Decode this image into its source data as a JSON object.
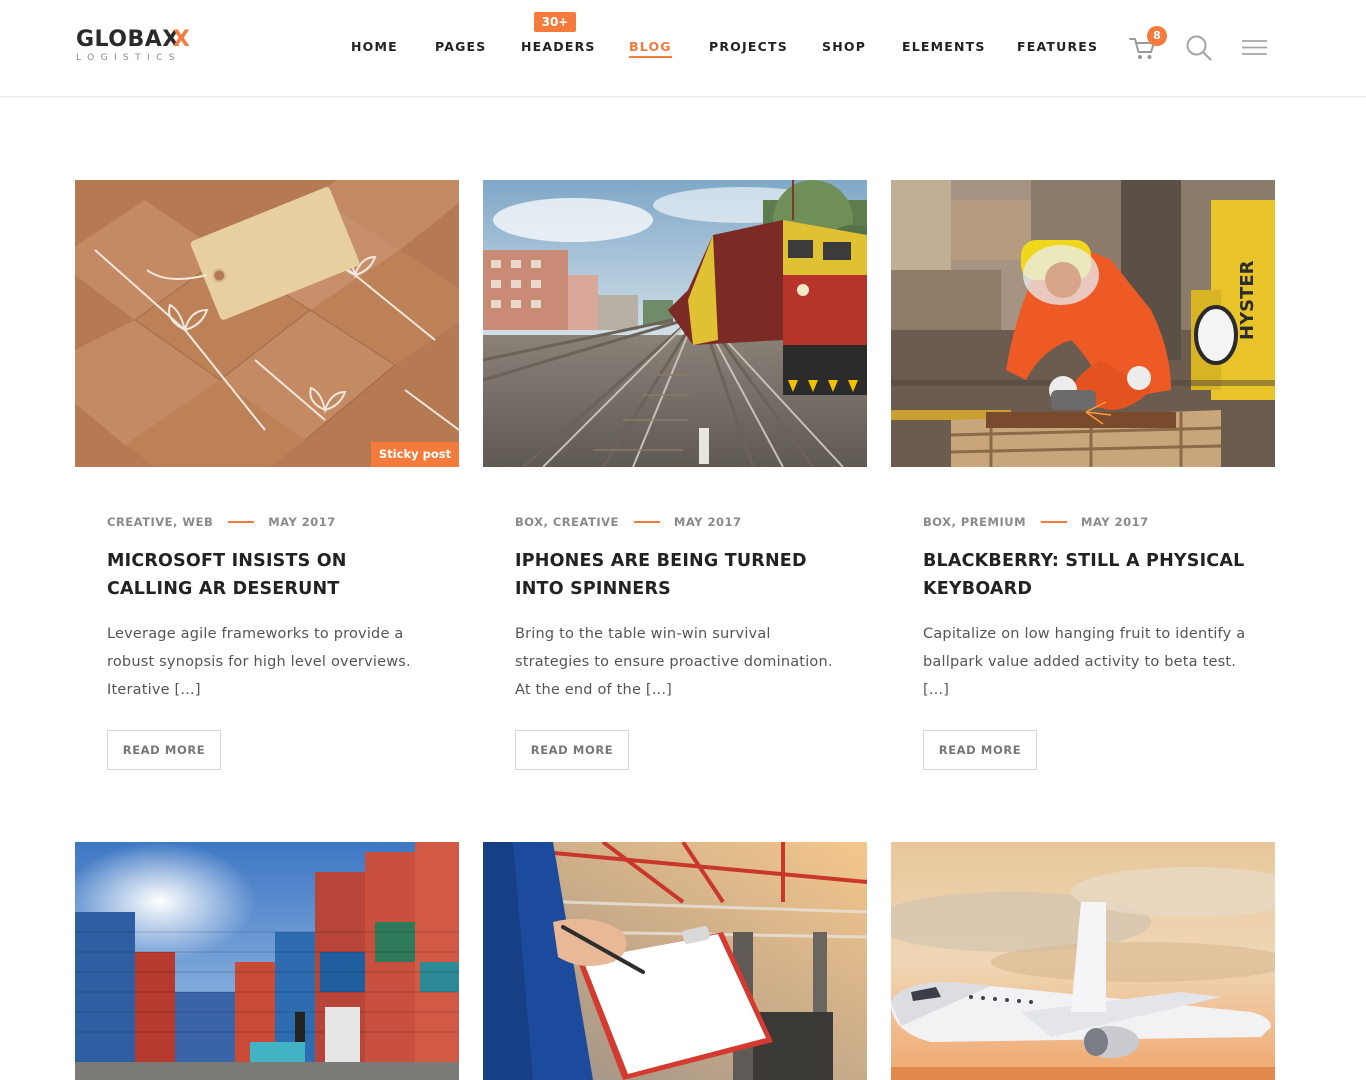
{
  "brand": {
    "name_main": "GLOBA",
    "name_x1": "X",
    "name_x2": "X",
    "tagline": "LOGISTICS",
    "accent_color": "#f47b3c"
  },
  "nav": {
    "items": [
      {
        "label": "HOME",
        "active": false
      },
      {
        "label": "PAGES",
        "active": false
      },
      {
        "label": "HEADERS",
        "active": false
      },
      {
        "label": "BLOG",
        "active": true
      },
      {
        "label": "PROJECTS",
        "active": false
      },
      {
        "label": "SHOP",
        "active": false
      },
      {
        "label": "ELEMENTS",
        "active": false
      },
      {
        "label": "FEATURES",
        "active": false
      }
    ],
    "headers_badge": "30+",
    "cart_count": "8",
    "icons": [
      "cart-icon",
      "search-icon",
      "hamburger-menu-icon"
    ]
  },
  "posts": [
    {
      "image": "brown-parcels-with-tag",
      "sticky_label": "Sticky post",
      "categories": "CREATIVE, WEB",
      "date": "MAY 2017",
      "title": "MICROSOFT INSISTS ON CALLING AR DESERUNT",
      "excerpt": "Leverage agile frameworks to provide a robust synopsis for high level overviews. Iterative [...]",
      "read_more": "READ MORE"
    },
    {
      "image": "locomotive-on-railway",
      "categories": "BOX, CREATIVE",
      "date": "MAY 2017",
      "title": "IPHONES ARE BEING TURNED INTO SPINNERS",
      "excerpt": "Bring to the table win-win survival strategies to ensure proactive domination. At the end of the [...]",
      "read_more": "READ MORE"
    },
    {
      "image": "worker-grinding-in-warehouse",
      "categories": "BOX, PREMIUM",
      "date": "MAY 2017",
      "title": "BLACKBERRY: STILL A PHYSICAL KEYBOARD",
      "excerpt": "Capitalize on low hanging fruit to identify a ballpark value added activity to beta test. [...]",
      "read_more": "READ MORE"
    },
    {
      "image": "shipping-containers-yard"
    },
    {
      "image": "clipboard-in-warehouse"
    },
    {
      "image": "airplane-at-sunset"
    }
  ]
}
